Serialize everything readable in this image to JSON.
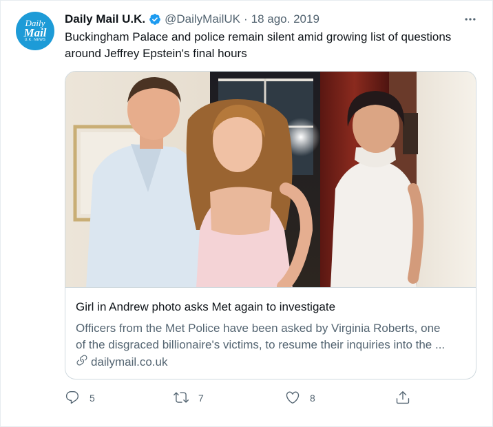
{
  "account": {
    "name": "Daily Mail U.K.",
    "handle": "@DailyMailUK",
    "separator": "·",
    "date": "18 ago. 2019",
    "avatar_line1": "Daily",
    "avatar_line2": "Mail",
    "avatar_line3": "U.K. NEWS"
  },
  "tweet": {
    "text_line1": "Buckingham Palace and police remain silent amid growing list of questions",
    "text_line2": "around Jeffrey Epstein's final hours"
  },
  "card": {
    "title": "Girl in Andrew photo asks Met again to investigate",
    "description_line1": "Officers from the Met Police have been asked by Virginia Roberts, one",
    "description_line2": "of the disgraced billionaire's victims, to resume their inquiries into the ...",
    "domain": "dailymail.co.uk",
    "image_alt": "Photo of three people standing indoors"
  },
  "actions": {
    "replies": "5",
    "retweets": "7",
    "likes": "8"
  },
  "icons": {
    "verified": "verified-badge-icon",
    "more": "more-icon",
    "link": "link-icon",
    "reply": "reply-icon",
    "retweet": "retweet-icon",
    "like": "heart-icon",
    "share": "share-icon"
  },
  "colors": {
    "avatar_bg": "#1d9bd7",
    "verified": "#1d9bf0",
    "secondary_text": "#536471",
    "primary_text": "#0f1419",
    "border": "#cfd9de"
  }
}
